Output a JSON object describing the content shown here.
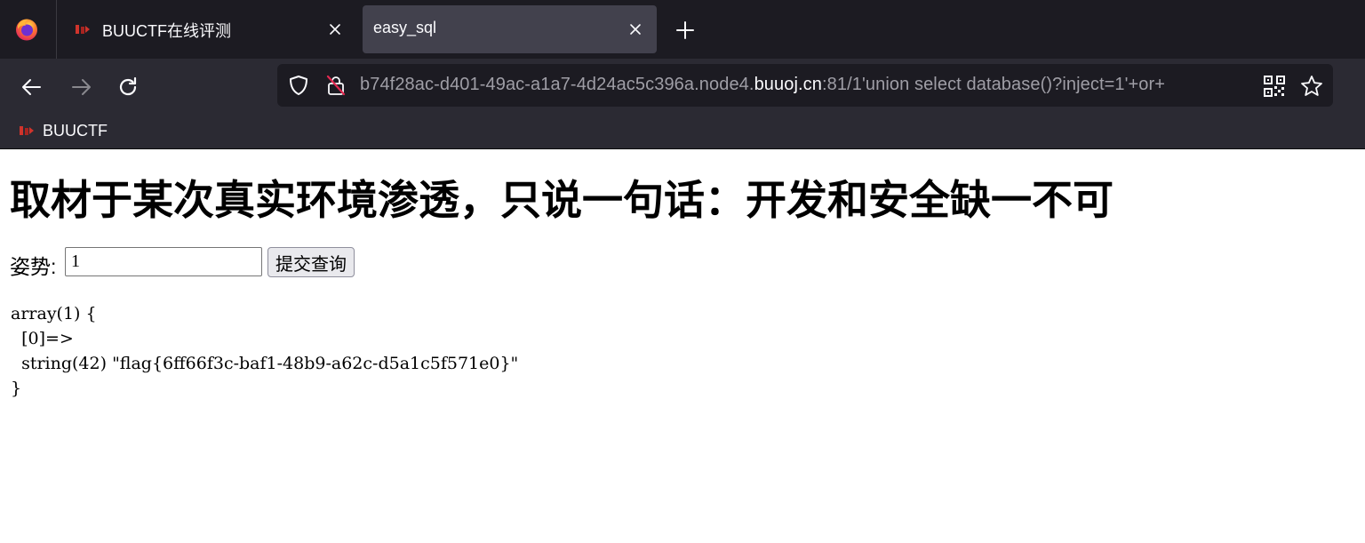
{
  "browser": {
    "app_icon": "firefox-logo",
    "tabs": [
      {
        "title": "BUUCTF在线评测",
        "icon": "buuctf-favicon",
        "active": false
      },
      {
        "title": "easy_sql",
        "active": true
      }
    ],
    "nav": {
      "back_icon": "arrow-left-icon",
      "forward_icon": "arrow-right-icon",
      "reload_icon": "reload-icon"
    },
    "url": {
      "prefix": "b74f28ac-d401-49ac-a1a7-4d24ac5c396a.node4.",
      "host": "buuoj.cn",
      "suffix": ":81/1'union select database()?inject=1'+or+"
    },
    "bookmarks": [
      {
        "label": "BUUCTF",
        "icon": "buuctf-favicon"
      }
    ]
  },
  "page": {
    "title": "取材于某次真实环境渗透，只说一句话：开发和安全缺一不可",
    "form": {
      "label": "姿势:",
      "input_value": "1",
      "submit_label": "提交查询"
    },
    "output": {
      "line1": "array(1) {",
      "line2": "  [0]=>",
      "line3": "  string(42) \"flag{6ff66f3c-baf1-48b9-a62c-d5a1c5f571e0}\"",
      "line4": "}"
    }
  },
  "colors": {
    "tabbar_bg": "#1c1b22",
    "toolbar_bg": "#2b2a33",
    "active_tab_bg": "#42414d",
    "url_dim_text": "#9f9ea6",
    "chrome_text": "#fbfbfe",
    "favicon_red": "#d0342c"
  }
}
